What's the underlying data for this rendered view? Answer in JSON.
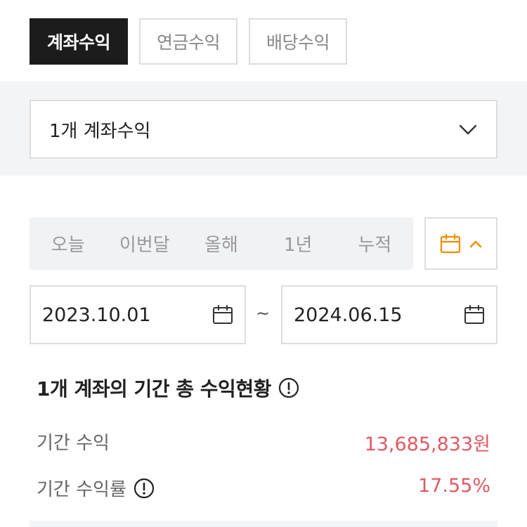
{
  "tabs": [
    {
      "label": "계좌수익",
      "active": true
    },
    {
      "label": "연금수익",
      "active": false
    },
    {
      "label": "배당수익",
      "active": false
    }
  ],
  "account_select": {
    "value": "1개 계좌수익",
    "icon": "chevron-down-icon"
  },
  "periods": [
    "오늘",
    "이번달",
    "올해",
    "1년",
    "누적"
  ],
  "calendar_toggle": {
    "icon": "calendar-icon",
    "chevron": "chevron-up-icon",
    "color": "#f08c00"
  },
  "dates": {
    "start": "2023.10.01",
    "separator": "~",
    "end": "2024.06.15"
  },
  "summary": {
    "heading": "1개 계좌의 기간 총 수익현황",
    "rows": [
      {
        "label": "기간 수익",
        "value": "13,685,833원",
        "info": false
      },
      {
        "label": "기간 수익률",
        "value": "17.55%",
        "info": true
      }
    ]
  },
  "colors": {
    "accent": "#f08c00",
    "profit": "#e05a63",
    "active_tab": "#1c1c1c"
  }
}
